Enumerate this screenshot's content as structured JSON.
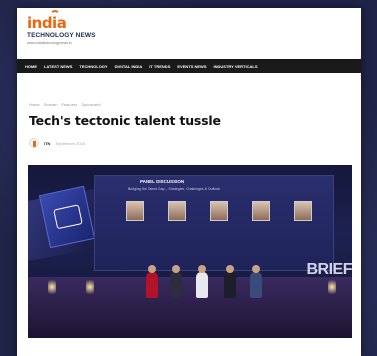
{
  "site": {
    "logo_top": "india",
    "logo_sub": "TECHNOLOGY NEWS",
    "logo_tag": "www.indiatechnologynews.in"
  },
  "nav": {
    "items": [
      "HOME",
      "LATEST NEWS",
      "TECHNOLOGY",
      "DIGITAL INDIA",
      "IT TRENDS",
      "EVENTS NEWS",
      "INDUSTRY VERTICALS"
    ]
  },
  "breadcrumb": [
    "Home",
    "Domain",
    "Features",
    "Sponsored"
  ],
  "article": {
    "headline": "Tech's tectonic talent tussle",
    "author": "ITN",
    "date": "September 2023"
  },
  "hero": {
    "screen_title": "PANEL DISCUSSION",
    "screen_sub": "Bridging the Talent Gap – Strategies, Challenges & Outlook",
    "stage_text": "BRIEF"
  },
  "colors": {
    "brand": "#e86a10",
    "nav_bg": "#1a1a1a",
    "backdrop": "#1f2347"
  }
}
